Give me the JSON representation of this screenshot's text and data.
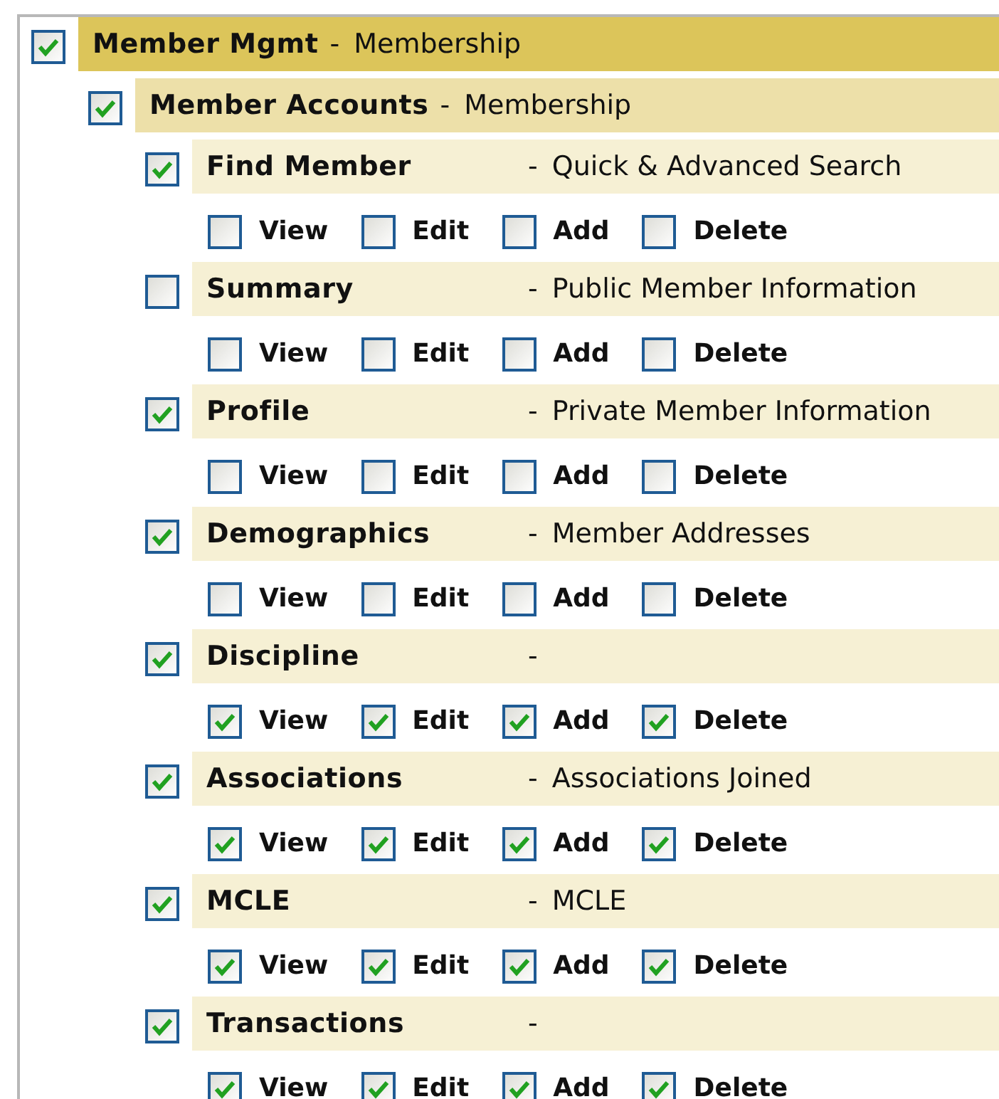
{
  "tree": [
    {
      "title": "Member Mgmt",
      "separator": "-",
      "description": "Membership",
      "checked": true,
      "children": [
        {
          "title": "Member Accounts",
          "separator": "-",
          "description": "Membership",
          "checked": true,
          "children": [
            {
              "title": "Find Member",
              "separator": "-",
              "description": "Quick & Advanced Search",
              "checked": true,
              "permissions": [
                {
                  "label": "View",
                  "checked": false
                },
                {
                  "label": "Edit",
                  "checked": false
                },
                {
                  "label": "Add",
                  "checked": false
                },
                {
                  "label": "Delete",
                  "checked": false
                }
              ]
            },
            {
              "title": "Summary",
              "separator": "-",
              "description": "Public Member Information",
              "checked": false,
              "permissions": [
                {
                  "label": "View",
                  "checked": false
                },
                {
                  "label": "Edit",
                  "checked": false
                },
                {
                  "label": "Add",
                  "checked": false
                },
                {
                  "label": "Delete",
                  "checked": false
                }
              ]
            },
            {
              "title": "Profile",
              "separator": "-",
              "description": "Private Member Information",
              "checked": true,
              "permissions": [
                {
                  "label": "View",
                  "checked": false
                },
                {
                  "label": "Edit",
                  "checked": false
                },
                {
                  "label": "Add",
                  "checked": false
                },
                {
                  "label": "Delete",
                  "checked": false
                }
              ]
            },
            {
              "title": "Demographics",
              "separator": "-",
              "description": "Member Addresses",
              "checked": true,
              "permissions": [
                {
                  "label": "View",
                  "checked": false
                },
                {
                  "label": "Edit",
                  "checked": false
                },
                {
                  "label": "Add",
                  "checked": false
                },
                {
                  "label": "Delete",
                  "checked": false
                }
              ]
            },
            {
              "title": "Discipline",
              "separator": "-",
              "checked": true,
              "permissions": [
                {
                  "label": "View",
                  "checked": true
                },
                {
                  "label": "Edit",
                  "checked": true
                },
                {
                  "label": "Add",
                  "checked": true
                },
                {
                  "label": "Delete",
                  "checked": true
                }
              ]
            },
            {
              "title": "Associations",
              "separator": "-",
              "description": "Associations Joined",
              "checked": true,
              "permissions": [
                {
                  "label": "View",
                  "checked": true
                },
                {
                  "label": "Edit",
                  "checked": true
                },
                {
                  "label": "Add",
                  "checked": true
                },
                {
                  "label": "Delete",
                  "checked": true
                }
              ]
            },
            {
              "title": "MCLE",
              "separator": "-",
              "description": "MCLE",
              "checked": true,
              "permissions": [
                {
                  "label": "View",
                  "checked": true
                },
                {
                  "label": "Edit",
                  "checked": true
                },
                {
                  "label": "Add",
                  "checked": true
                },
                {
                  "label": "Delete",
                  "checked": true
                }
              ]
            },
            {
              "title": "Transactions",
              "separator": "-",
              "checked": true,
              "permissions": [
                {
                  "label": "View",
                  "checked": true
                },
                {
                  "label": "Edit",
                  "checked": true
                },
                {
                  "label": "Add",
                  "checked": true
                },
                {
                  "label": "Delete",
                  "checked": true
                }
              ]
            }
          ]
        }
      ]
    }
  ]
}
